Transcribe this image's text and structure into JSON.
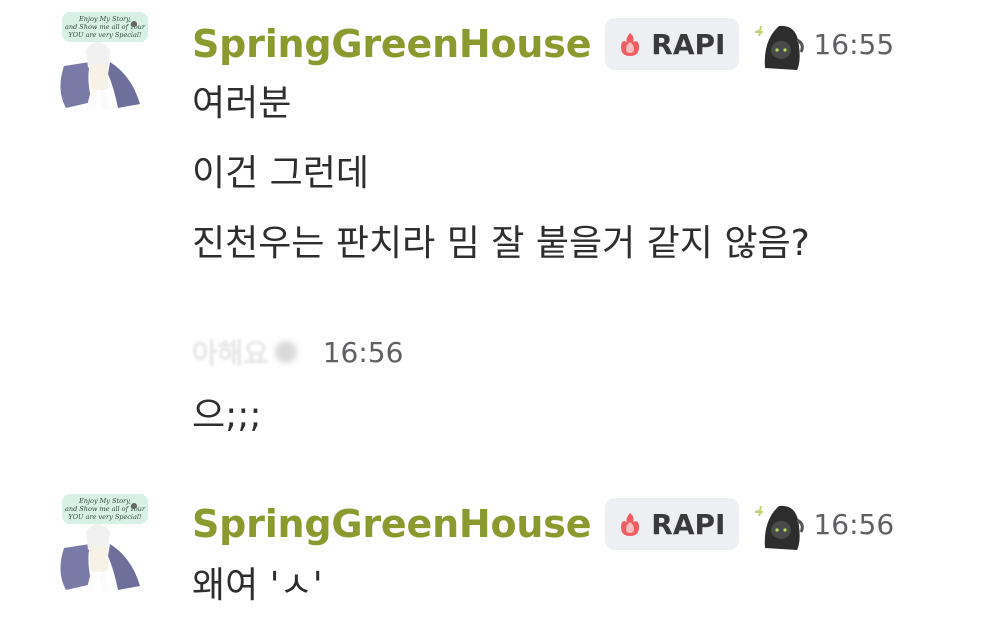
{
  "messages": [
    {
      "username": "SpringGreenHouse",
      "tag": "RAPI",
      "time": "16:55",
      "avatar_text": [
        "Enjoy My Story,",
        "and Show me all of Your",
        "YOU are very Special!"
      ],
      "lines": [
        "여러분",
        "이건 그런데",
        "진천우는 판치라 밈 잘 붙을거 같지 않음?"
      ]
    },
    {
      "username": "아해요",
      "time": "16:56",
      "lines": [
        "으;;;"
      ]
    },
    {
      "username": "SpringGreenHouse",
      "tag": "RAPI",
      "time": "16:56",
      "avatar_text": [
        "Enjoy My Story,",
        "and Show me all of Your",
        "YOU are very Special!"
      ],
      "lines": [
        "왜여 'ㅅ'"
      ]
    }
  ],
  "colors": {
    "username": "#8a9a2e",
    "tag_bg": "#eeeff2",
    "time": "#5e6063",
    "text": "#2e2e2e"
  },
  "icons": {
    "tag_icon": "flame-heart-icon",
    "role_icon": "hooded-character-icon",
    "avatar": "anime-girl-avatar"
  }
}
